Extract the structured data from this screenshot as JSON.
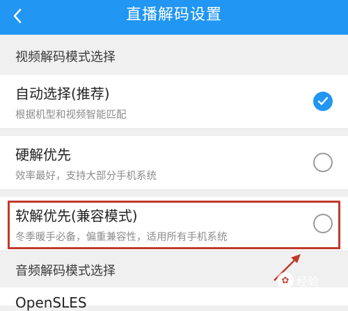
{
  "header": {
    "title": "直播解码设置",
    "back_icon": "back-arrow-icon",
    "color": "#2196f3"
  },
  "video_section": {
    "label": "视频解码模式选择"
  },
  "options": [
    {
      "title": "自动选择(推荐)",
      "subtitle": "根据机型和视频智能匹配",
      "selected": true
    },
    {
      "title": "硬解优先",
      "subtitle": "效率最好，支持大部分手机系统",
      "selected": false
    },
    {
      "title": "软解优先(兼容模式)",
      "subtitle": "冬季暖手必备，偏重兼容性，适用所有手机系统",
      "selected": false
    }
  ],
  "audio_section": {
    "label": "音频解码模式选择"
  },
  "partial_item": {
    "title": "OpenSLES"
  },
  "annotation": {
    "highlight_color": "#c0392b"
  },
  "watermark": {
    "text": "经验"
  }
}
